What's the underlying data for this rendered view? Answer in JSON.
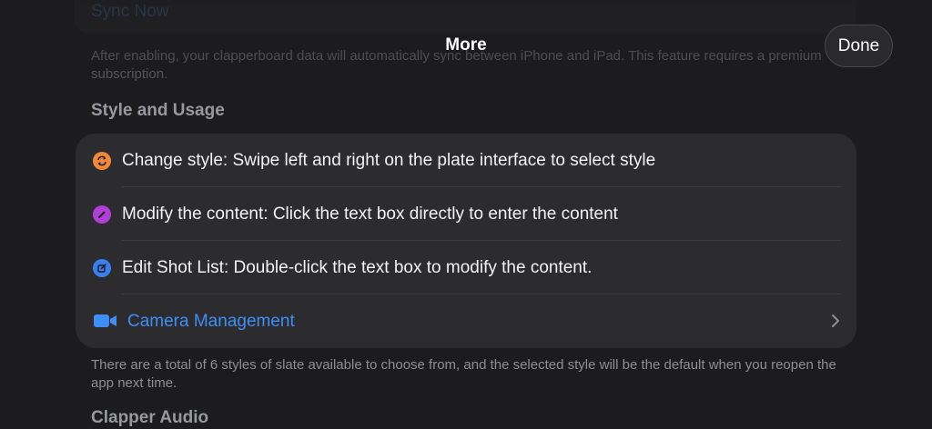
{
  "nav": {
    "title": "More",
    "done_label": "Done"
  },
  "sync": {
    "button_label": "Sync Now",
    "footnote": "After enabling, your clapperboard data will automatically sync between iPhone and iPad. This feature requires a premium subscription."
  },
  "style_usage": {
    "header": "Style and Usage",
    "items": [
      {
        "label": "Change style: Swipe left and right on the plate interface to select style",
        "icon": "arrows-cycle-icon",
        "color": "#f0883a"
      },
      {
        "label": "Modify the content: Click the text box directly to enter the content",
        "icon": "pencil-icon",
        "color": "#b03fd6"
      },
      {
        "label": "Edit Shot List: Double-click the text box to modify the content.",
        "icon": "edit-square-icon",
        "color": "#3a7ff0"
      },
      {
        "label": "Camera Management",
        "icon": "video-camera-icon",
        "color": "#3e8ef7"
      }
    ],
    "footnote": "There are a total of 6 styles of slate available to choose from, and the selected style will be the default when you reopen the app next time."
  },
  "clapper_audio": {
    "header": "Clapper Audio"
  }
}
